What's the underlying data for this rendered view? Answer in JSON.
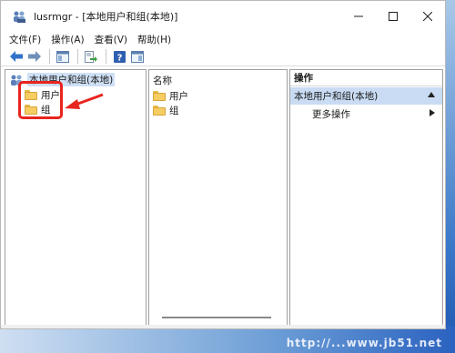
{
  "window": {
    "title": "lusrmgr - [本地用户和组(本地)]"
  },
  "menu": [
    "文件(F)",
    "操作(A)",
    "查看(V)",
    "帮助(H)"
  ],
  "toolbar": {
    "buttons": [
      "back-arrow-icon",
      "forward-arrow-icon",
      "show-tree-icon",
      "export-list-icon",
      "help-icon",
      "show-action-pane-icon"
    ]
  },
  "tree": {
    "root_label": "本地用户和组(本地)",
    "children": [
      "用户",
      "组"
    ]
  },
  "list": {
    "column_header": "名称",
    "items": [
      "用户",
      "组"
    ]
  },
  "actions": {
    "header": "操作",
    "section_label": "本地用户和组(本地)",
    "item_label": "更多操作"
  },
  "colors": {
    "highlight_red": "#e8251f",
    "selection_blue": "#c9dcf3",
    "folder_yellow": "#f5cd62"
  },
  "watermark": "http://...www.jb51.net"
}
